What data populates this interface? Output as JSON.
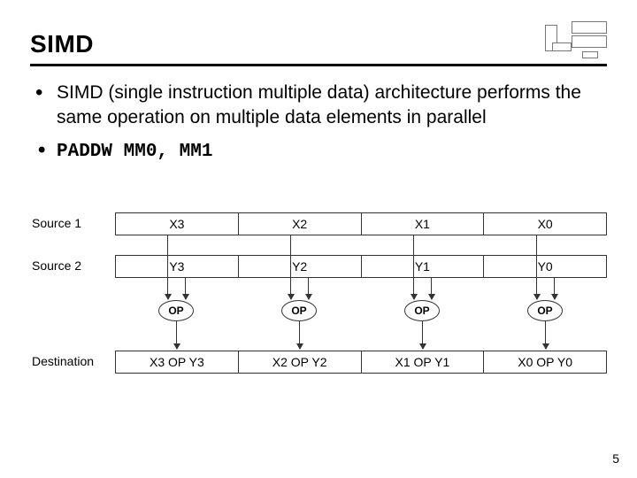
{
  "title": "SIMD",
  "bullets": [
    "SIMD (single instruction multiple data) architecture performs the same operation on multiple data elements in parallel",
    "PADDW MM0, MM1"
  ],
  "labels": {
    "src1": "Source 1",
    "src2": "Source 2",
    "dest": "Destination",
    "op": "OP"
  },
  "src1": [
    "X3",
    "X2",
    "X1",
    "X0"
  ],
  "src2": [
    "Y3",
    "Y2",
    "Y1",
    "Y0"
  ],
  "dest": [
    "X3 OP Y3",
    "X2 OP Y2",
    "X1 OP Y1",
    "X0 OP Y0"
  ],
  "page": "5"
}
